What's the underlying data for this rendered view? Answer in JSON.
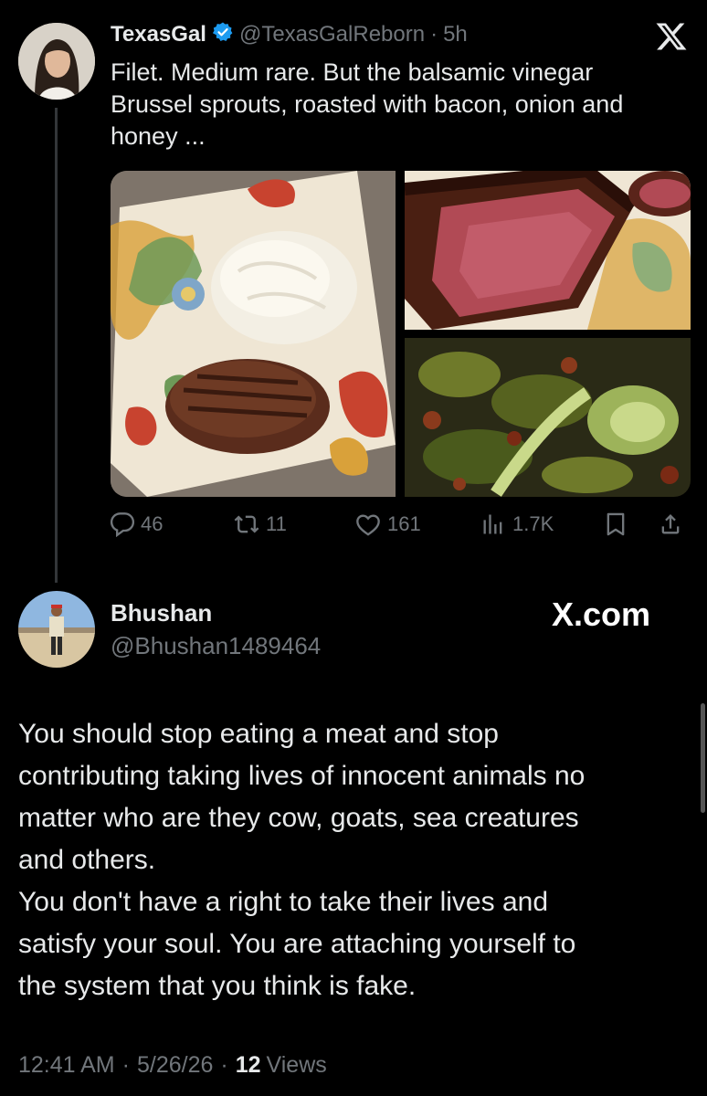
{
  "tweet": {
    "author_name": "TexasGal",
    "handle": "@TexasGalReborn",
    "dot": "·",
    "time": "5h",
    "text_lines": [
      "Filet. Medium rare. But the balsamic vinegar",
      "Brussel sprouts, roasted with bacon, onion and",
      "honey ..."
    ],
    "actions": {
      "replies": "46",
      "reposts": "11",
      "likes": "161",
      "views": "1.7K"
    }
  },
  "reply": {
    "author_name": "Bhushan",
    "handle": "@Bhushan1489464",
    "watermark": "X.com",
    "text_lines": [
      "You should stop eating a meat and stop",
      "contributing taking lives of innocent animals no",
      "matter who are they cow, goats, sea creatures",
      "and others.",
      "You don't have a right to take their lives and",
      "satisfy your soul. You are attaching yourself to",
      "the system that you think is fake."
    ],
    "meta": {
      "time": "12:41 AM",
      "sep1": "·",
      "date": "5/26/26",
      "sep2": "·",
      "views_count": "12",
      "views_label": "Views"
    }
  },
  "icons": {
    "x_logo": "x-logo-icon",
    "verified": "verified-badge-icon",
    "reply": "reply-icon",
    "repost": "repost-icon",
    "like": "heart-icon",
    "views": "views-bar-chart-icon",
    "bookmark": "bookmark-icon",
    "share": "share-icon"
  },
  "colors": {
    "background": "#000000",
    "text": "#e7e9ea",
    "muted": "#71767b",
    "verified": "#1d9bf0"
  }
}
